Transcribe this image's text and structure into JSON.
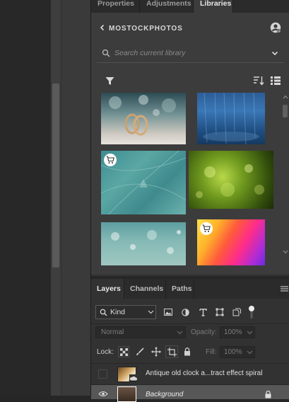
{
  "tabs": [
    "Properties",
    "Adjustments",
    "Libraries"
  ],
  "libraries": {
    "title": "MOSTOCKPHOTOS",
    "search_placeholder": "Search current library"
  },
  "layers_panel": {
    "tabs": [
      "Layers",
      "Channels",
      "Paths"
    ],
    "kind_label": "Kind",
    "blend_mode": "Normal",
    "opacity_label": "Opacity:",
    "opacity_value": "100%",
    "lock_label": "Lock:",
    "fill_label": "Fill:",
    "fill_value": "100%",
    "layers": [
      {
        "name": "Antique old clock a...tract effect spiral"
      },
      {
        "name": "Background"
      }
    ]
  },
  "colors": {
    "accent": "#2d8ceb",
    "panel": "#323232"
  }
}
